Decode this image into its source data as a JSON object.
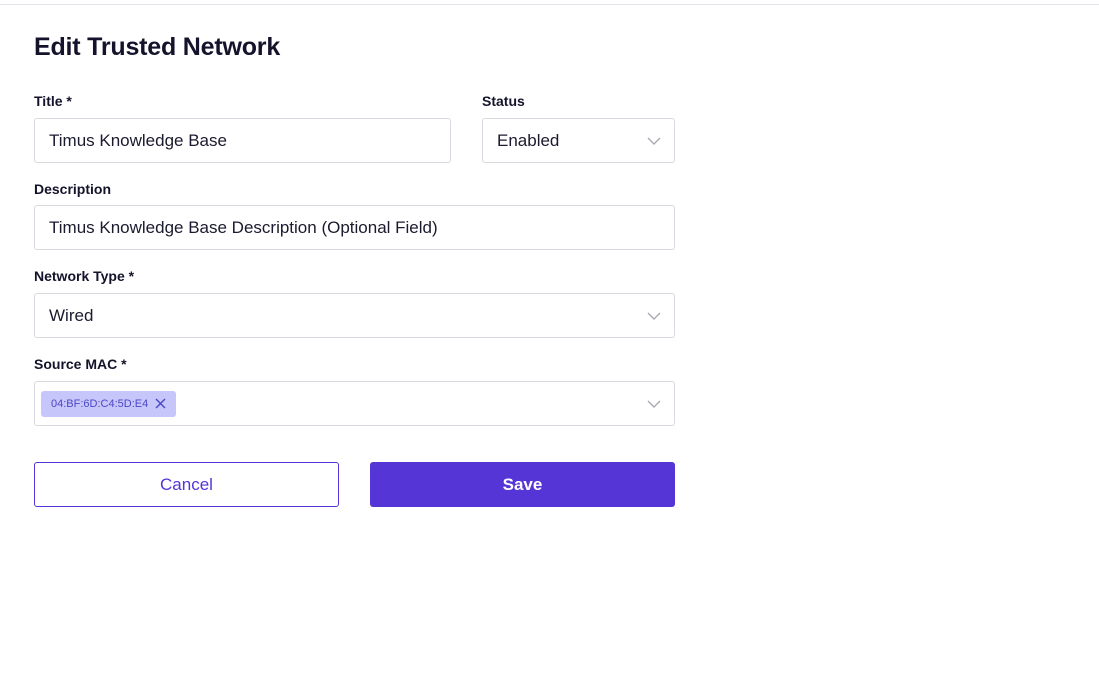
{
  "form": {
    "title": "Edit Trusted Network",
    "title_field": {
      "label": "Title *",
      "value": "Timus Knowledge Base"
    },
    "status_field": {
      "label": "Status",
      "value": "Enabled"
    },
    "description_field": {
      "label": "Description",
      "value": "Timus Knowledge Base Description (Optional Field)"
    },
    "network_type_field": {
      "label": "Network Type *",
      "value": "Wired"
    },
    "source_mac_field": {
      "label": "Source MAC *",
      "chips": [
        "04:BF:6D:C4:5D:E4"
      ]
    },
    "cancel_label": "Cancel",
    "save_label": "Save"
  },
  "colors": {
    "accent": "#5535d6",
    "chip_bg": "#c7c6fa",
    "chip_text": "#4b46c7",
    "border": "#d9d9e0"
  },
  "icons": {
    "dropdown": "chevron-down-icon",
    "chip_remove": "close-icon"
  }
}
